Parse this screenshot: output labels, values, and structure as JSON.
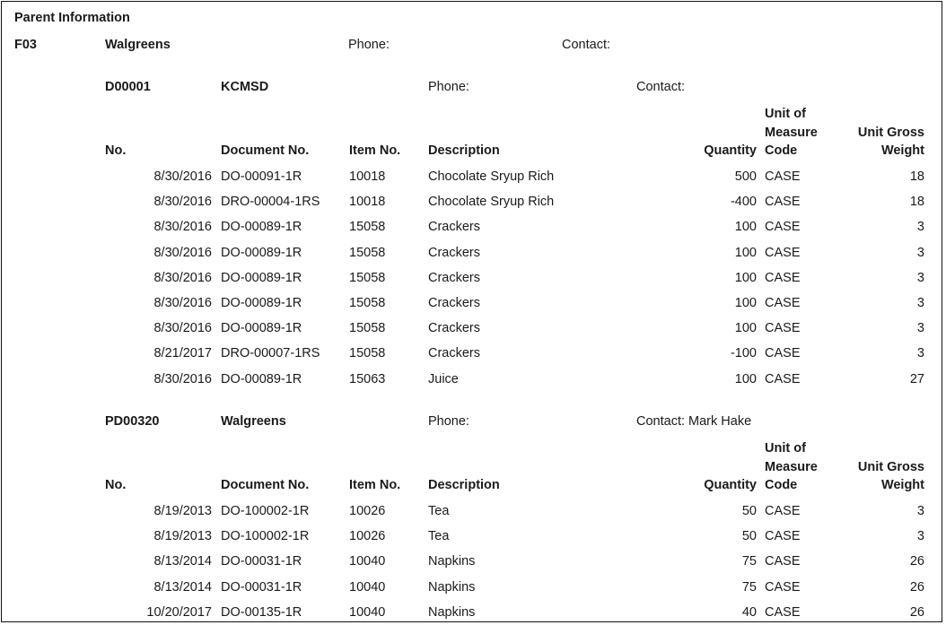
{
  "report": {
    "title": "Parent  Information",
    "parent": {
      "code": "F03",
      "name": "Walgreens",
      "phone_label": "Phone:",
      "contact_label": "Contact:"
    }
  },
  "groups": [
    {
      "code": "D00001",
      "name": "KCMSD",
      "phone_label": "Phone:",
      "contact_label": "Contact:",
      "headers": {
        "no": "No.",
        "document_no": "Document No.",
        "item_no": "Item No.",
        "description": "Description",
        "quantity": "Quantity",
        "uom_line1": "Unit of",
        "uom_line2": "Measure",
        "uom_line3": "Code",
        "ugw_line1": "Unit Gross",
        "ugw_line2": "Weight"
      },
      "rows": [
        {
          "date": "8/30/2016",
          "document_no": "DO-00091-1R",
          "item_no": "10018",
          "description": "Chocolate Sryup Rich",
          "quantity": "500",
          "uom": "CASE",
          "weight": "18"
        },
        {
          "date": "8/30/2016",
          "document_no": "DRO-00004-1RS",
          "item_no": "10018",
          "description": "Chocolate Sryup Rich",
          "quantity": "-400",
          "uom": "CASE",
          "weight": "18"
        },
        {
          "date": "8/30/2016",
          "document_no": "DO-00089-1R",
          "item_no": "15058",
          "description": "Crackers",
          "quantity": "100",
          "uom": "CASE",
          "weight": "3"
        },
        {
          "date": "8/30/2016",
          "document_no": "DO-00089-1R",
          "item_no": "15058",
          "description": "Crackers",
          "quantity": "100",
          "uom": "CASE",
          "weight": "3"
        },
        {
          "date": "8/30/2016",
          "document_no": "DO-00089-1R",
          "item_no": "15058",
          "description": "Crackers",
          "quantity": "100",
          "uom": "CASE",
          "weight": "3"
        },
        {
          "date": "8/30/2016",
          "document_no": "DO-00089-1R",
          "item_no": "15058",
          "description": "Crackers",
          "quantity": "100",
          "uom": "CASE",
          "weight": "3"
        },
        {
          "date": "8/30/2016",
          "document_no": "DO-00089-1R",
          "item_no": "15058",
          "description": "Crackers",
          "quantity": "100",
          "uom": "CASE",
          "weight": "3"
        },
        {
          "date": "8/21/2017",
          "document_no": "DRO-00007-1RS",
          "item_no": "15058",
          "description": "Crackers",
          "quantity": "-100",
          "uom": "CASE",
          "weight": "3"
        },
        {
          "date": "8/30/2016",
          "document_no": "DO-00089-1R",
          "item_no": "15063",
          "description": "Juice",
          "quantity": "100",
          "uom": "CASE",
          "weight": "27"
        }
      ]
    },
    {
      "code": "PD00320",
      "name": "Walgreens",
      "phone_label": "Phone:",
      "contact_label": "Contact: Mark Hake",
      "headers": {
        "no": "No.",
        "document_no": "Document No.",
        "item_no": "Item No.",
        "description": "Description",
        "quantity": "Quantity",
        "uom_line1": "Unit of",
        "uom_line2": "Measure",
        "uom_line3": "Code",
        "ugw_line1": "Unit Gross",
        "ugw_line2": "Weight"
      },
      "rows": [
        {
          "date": "8/19/2013",
          "document_no": "DO-100002-1R",
          "item_no": "10026",
          "description": "Tea",
          "quantity": "50",
          "uom": "CASE",
          "weight": "3"
        },
        {
          "date": "8/19/2013",
          "document_no": "DO-100002-1R",
          "item_no": "10026",
          "description": "Tea",
          "quantity": "50",
          "uom": "CASE",
          "weight": "3"
        },
        {
          "date": "8/13/2014",
          "document_no": "DO-00031-1R",
          "item_no": "10040",
          "description": "Napkins",
          "quantity": "75",
          "uom": "CASE",
          "weight": "26"
        },
        {
          "date": "8/13/2014",
          "document_no": "DO-00031-1R",
          "item_no": "10040",
          "description": "Napkins",
          "quantity": "75",
          "uom": "CASE",
          "weight": "26"
        },
        {
          "date": "10/20/2017",
          "document_no": "DO-00135-1R",
          "item_no": "10040",
          "description": "Napkins",
          "quantity": "40",
          "uom": "CASE",
          "weight": "26"
        }
      ]
    }
  ]
}
